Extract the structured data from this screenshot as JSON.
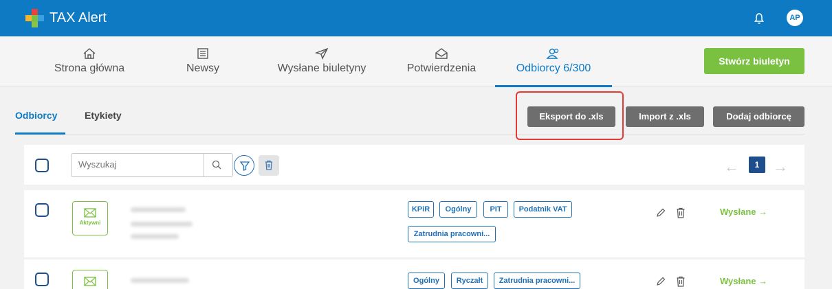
{
  "app": {
    "title": "TAX Alert",
    "avatar_initials": "AP",
    "accent_color": "#0e7ac4",
    "green_color": "#7ac142"
  },
  "nav": {
    "items": [
      {
        "label": "Strona główna",
        "icon": "home-icon"
      },
      {
        "label": "Newsy",
        "icon": "newspaper-icon"
      },
      {
        "label": "Wysłane biuletyny",
        "icon": "send-icon"
      },
      {
        "label": "Potwierdzenia",
        "icon": "envelope-open-icon"
      },
      {
        "label": "Odbiorcy 6/300",
        "icon": "users-icon",
        "active": true
      }
    ],
    "create_label": "Stwórz biuletyn"
  },
  "subtabs": [
    {
      "label": "Odbiorcy",
      "active": true
    },
    {
      "label": "Etykiety",
      "active": false
    }
  ],
  "actions": {
    "export_label": "Eksport do .xls",
    "import_label": "Import z .xls",
    "add_label": "Dodaj odbiorcę"
  },
  "toolbar": {
    "search_placeholder": "Wyszukaj",
    "current_page": "1"
  },
  "recipients": [
    {
      "status": "Aktywni",
      "tags": [
        "KPiR",
        "Ogólny",
        "PIT",
        "Podatnik VAT",
        "Zatrudnia pracowni..."
      ],
      "sent_label": "Wysłane →"
    },
    {
      "status": "",
      "tags": [
        "Ogólny",
        "Ryczałt",
        "Zatrudnia pracowni..."
      ],
      "sent_label": "Wysłane →"
    }
  ]
}
